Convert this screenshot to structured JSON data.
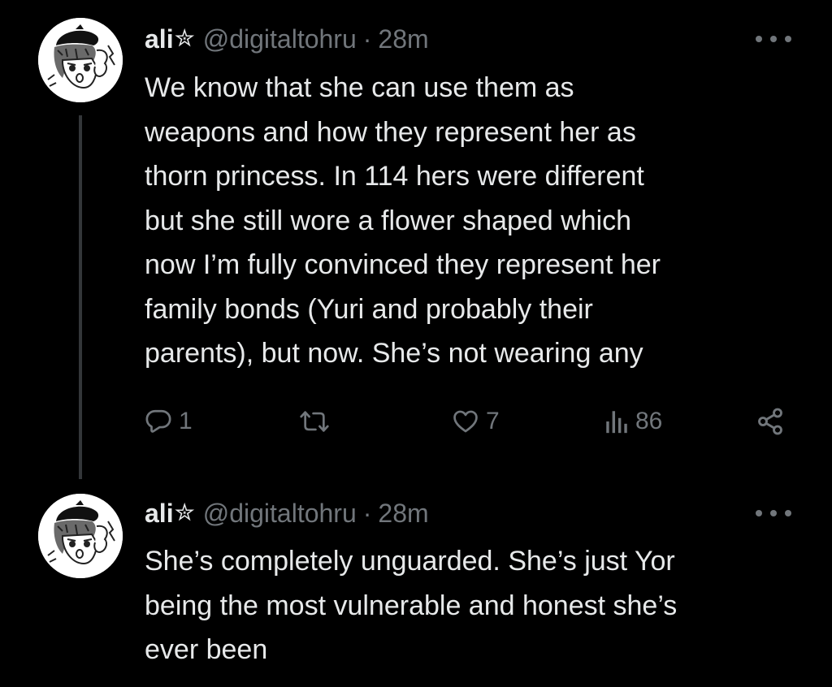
{
  "colors": {
    "background": "#000000",
    "text": "#e7e9ea",
    "secondary": "#71767b",
    "thread_line": "#333639"
  },
  "tweets": [
    {
      "author": {
        "name": "ali",
        "badge": "✮",
        "handle": "@digitaltohru"
      },
      "separator": "·",
      "time": "28m",
      "text_lines": [
        "We know that she can use them as",
        "weapons and how they represent her as",
        "thorn princess. In 114 hers were different",
        "but she still wore a flower shaped which",
        "now I’m fully convinced they represent her",
        "family bonds (Yuri and probably their",
        "parents), but now. She’s not wearing any"
      ],
      "actions": {
        "reply_icon": "reply-icon",
        "reply_count": "1",
        "retweet_icon": "retweet-icon",
        "like_icon": "like-icon",
        "like_count": "7",
        "views_icon": "views-icon",
        "views_count": "86",
        "share_icon": "share-icon"
      }
    },
    {
      "author": {
        "name": "ali",
        "badge": "✮",
        "handle": "@digitaltohru"
      },
      "separator": "·",
      "time": "28m",
      "text_lines": [
        "She’s completely unguarded. She’s just Yor",
        "being the most vulnerable and honest she’s",
        "ever been"
      ]
    }
  ]
}
